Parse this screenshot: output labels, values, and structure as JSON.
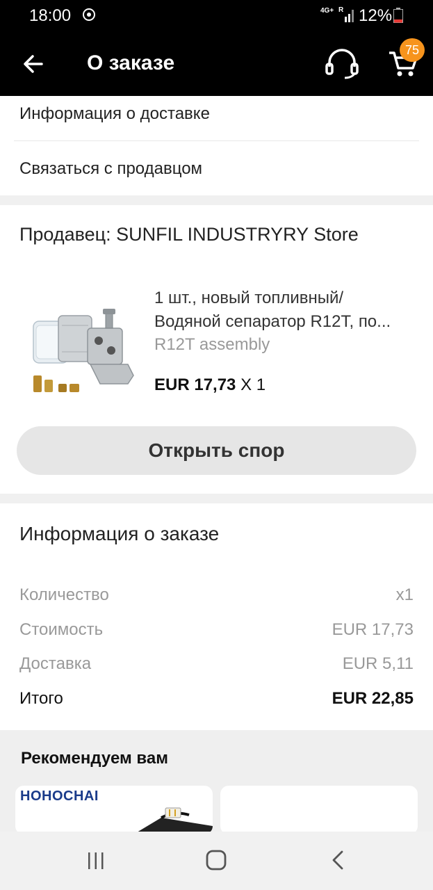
{
  "status_bar": {
    "time": "18:00",
    "network": "4G+",
    "network_r": "R",
    "battery": "12%"
  },
  "app_bar": {
    "title": "О заказе",
    "cart_count": "75",
    "back_icon": "arrow-left-icon",
    "support_icon": "headset-icon",
    "cart_icon": "cart-icon"
  },
  "menu": {
    "delivery_info": "Информация о доставке",
    "contact_seller": "Связаться с продавцом"
  },
  "seller": {
    "title": "Продавец: SUNFIL INDUSTRYRY Store",
    "product": {
      "title_line1": "1 шт., новый топливный/",
      "title_line2": "Водяной сепаратор R12T, по...",
      "variant": "R12T assembly",
      "price": "EUR 17,73",
      "quantity": "X 1"
    },
    "dispute_button": "Открыть спор"
  },
  "order_info": {
    "title": "Информация о заказе",
    "rows": [
      {
        "label": "Количество",
        "value": "x1"
      },
      {
        "label": "Стоимость",
        "value": "EUR 17,73"
      },
      {
        "label": "Доставка",
        "value": "EUR 5,11"
      },
      {
        "label": "Итого",
        "value": "EUR 22,85"
      }
    ]
  },
  "recommend": {
    "title": "Рекомендуем вам",
    "card1_brand": "HOHOCHAI"
  },
  "colors": {
    "accent": "#f7941d",
    "appbar": "#000000"
  }
}
